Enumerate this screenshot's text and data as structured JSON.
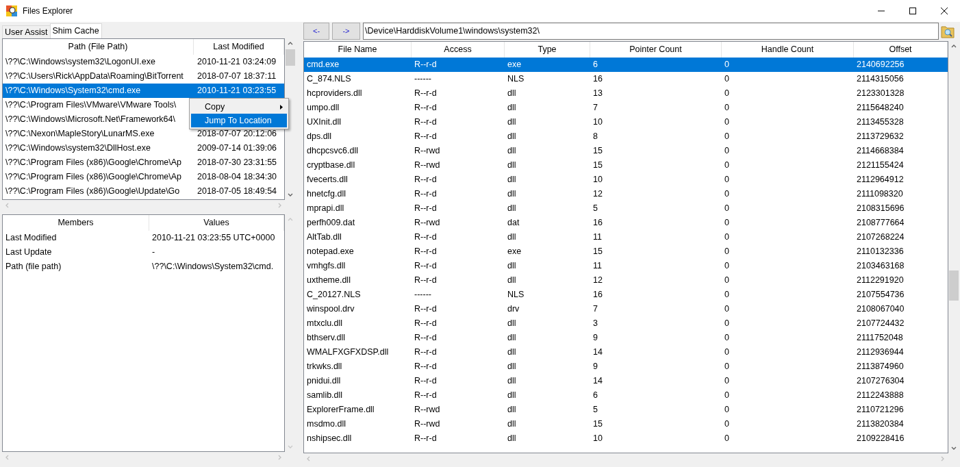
{
  "window": {
    "title": "Files Explorer"
  },
  "tabs": [
    {
      "label": "User Assist",
      "selected": false
    },
    {
      "label": "Shim Cache",
      "selected": true
    }
  ],
  "shim_table": {
    "columns": [
      "Path (File Path)",
      "Last Modified"
    ],
    "rows": [
      {
        "path": "\\??\\C:\\Windows\\system32\\LogonUI.exe",
        "last_modified": "2010-11-21 03:24:09",
        "selected": false
      },
      {
        "path": "\\??\\C:\\Users\\Rick\\AppData\\Roaming\\BitTorrent",
        "last_modified": "2018-07-07 18:37:11",
        "selected": false
      },
      {
        "path": "\\??\\C:\\Windows\\System32\\cmd.exe",
        "last_modified": "2010-11-21 03:23:55",
        "selected": true
      },
      {
        "path": "\\??\\C:\\Program Files\\VMware\\VMware Tools\\",
        "selected": false
      },
      {
        "path": "\\??\\C:\\Windows\\Microsoft.Net\\Framework64\\",
        "selected": false
      },
      {
        "path": "\\??\\C:\\Nexon\\MapleStory\\LunarMS.exe",
        "last_modified": "2018-07-07 20:12:06",
        "selected": false
      },
      {
        "path": "\\??\\C:\\Windows\\system32\\DllHost.exe",
        "last_modified": "2009-07-14 01:39:06",
        "selected": false
      },
      {
        "path": "\\??\\C:\\Program Files (x86)\\Google\\Chrome\\Ap",
        "last_modified": "2018-07-30 23:31:55",
        "selected": false
      },
      {
        "path": "\\??\\C:\\Program Files (x86)\\Google\\Chrome\\Ap",
        "last_modified": "2018-08-04 18:34:30",
        "selected": false
      },
      {
        "path": "\\??\\C:\\Program Files (x86)\\Google\\Update\\Go",
        "last_modified": "2018-07-05 18:49:54",
        "selected": false
      }
    ]
  },
  "context_menu": {
    "items": [
      {
        "label": "Copy",
        "submenu": true,
        "selected": false
      },
      {
        "label": "Jump To Location",
        "submenu": false,
        "selected": true
      }
    ]
  },
  "details": {
    "columns": [
      "Members",
      "Values"
    ],
    "rows": [
      {
        "member": "Last Modified",
        "value": "2010-11-21 03:23:55 UTC+0000"
      },
      {
        "member": "Last Update",
        "value": "-"
      },
      {
        "member": "Path (file path)",
        "value": "\\??\\C:\\Windows\\System32\\cmd."
      }
    ]
  },
  "navigation": {
    "back": "<-",
    "forward": "->",
    "path": "\\Device\\HarddiskVolume1\\windows\\system32\\"
  },
  "files": {
    "columns": [
      "File Name",
      "Access",
      "Type",
      "Pointer Count",
      "Handle Count",
      "Offset"
    ],
    "rows": [
      {
        "cells": [
          "cmd.exe",
          "R--r-d",
          "exe",
          "6",
          "0",
          "2140692256"
        ],
        "selected": true
      },
      {
        "cells": [
          "C_874.NLS",
          "------",
          "NLS",
          "16",
          "0",
          "2114315056"
        ],
        "selected": false
      },
      {
        "cells": [
          "hcproviders.dll",
          "R--r-d",
          "dll",
          "13",
          "0",
          "2123301328"
        ],
        "selected": false
      },
      {
        "cells": [
          "umpo.dll",
          "R--r-d",
          "dll",
          "7",
          "0",
          "2115648240"
        ],
        "selected": false
      },
      {
        "cells": [
          "UXInit.dll",
          "R--r-d",
          "dll",
          "10",
          "0",
          "2113455328"
        ],
        "selected": false
      },
      {
        "cells": [
          "dps.dll",
          "R--r-d",
          "dll",
          "8",
          "0",
          "2113729632"
        ],
        "selected": false
      },
      {
        "cells": [
          "dhcpcsvc6.dll",
          "R--rwd",
          "dll",
          "15",
          "0",
          "2114668384"
        ],
        "selected": false
      },
      {
        "cells": [
          "cryptbase.dll",
          "R--rwd",
          "dll",
          "15",
          "0",
          "2121155424"
        ],
        "selected": false
      },
      {
        "cells": [
          "fvecerts.dll",
          "R--r-d",
          "dll",
          "10",
          "0",
          "2112964912"
        ],
        "selected": false
      },
      {
        "cells": [
          "hnetcfg.dll",
          "R--r-d",
          "dll",
          "12",
          "0",
          "2111098320"
        ],
        "selected": false
      },
      {
        "cells": [
          "mprapi.dll",
          "R--r-d",
          "dll",
          "5",
          "0",
          "2108315696"
        ],
        "selected": false
      },
      {
        "cells": [
          "perfh009.dat",
          "R--rwd",
          "dat",
          "16",
          "0",
          "2108777664"
        ],
        "selected": false
      },
      {
        "cells": [
          "AltTab.dll",
          "R--r-d",
          "dll",
          "11",
          "0",
          "2107268224"
        ],
        "selected": false
      },
      {
        "cells": [
          "notepad.exe",
          "R--r-d",
          "exe",
          "15",
          "0",
          "2110132336"
        ],
        "selected": false
      },
      {
        "cells": [
          "vmhgfs.dll",
          "R--r-d",
          "dll",
          "11",
          "0",
          "2103463168"
        ],
        "selected": false
      },
      {
        "cells": [
          "uxtheme.dll",
          "R--r-d",
          "dll",
          "12",
          "0",
          "2112291920"
        ],
        "selected": false
      },
      {
        "cells": [
          "C_20127.NLS",
          "------",
          "NLS",
          "16",
          "0",
          "2107554736"
        ],
        "selected": false
      },
      {
        "cells": [
          "winspool.drv",
          "R--r-d",
          "drv",
          "7",
          "0",
          "2108067040"
        ],
        "selected": false
      },
      {
        "cells": [
          "mtxclu.dll",
          "R--r-d",
          "dll",
          "3",
          "0",
          "2107724432"
        ],
        "selected": false
      },
      {
        "cells": [
          "bthserv.dll",
          "R--r-d",
          "dll",
          "9",
          "0",
          "2111752048"
        ],
        "selected": false
      },
      {
        "cells": [
          "WMALFXGFXDSP.dll",
          "R--r-d",
          "dll",
          "14",
          "0",
          "2112936944"
        ],
        "selected": false
      },
      {
        "cells": [
          "trkwks.dll",
          "R--r-d",
          "dll",
          "9",
          "0",
          "2113874960"
        ],
        "selected": false
      },
      {
        "cells": [
          "pnidui.dll",
          "R--r-d",
          "dll",
          "14",
          "0",
          "2107276304"
        ],
        "selected": false
      },
      {
        "cells": [
          "samlib.dll",
          "R--r-d",
          "dll",
          "6",
          "0",
          "2112243888"
        ],
        "selected": false
      },
      {
        "cells": [
          "ExplorerFrame.dll",
          "R--rwd",
          "dll",
          "5",
          "0",
          "2110721296"
        ],
        "selected": false
      },
      {
        "cells": [
          "msdmo.dll",
          "R--rwd",
          "dll",
          "15",
          "0",
          "2113820384"
        ],
        "selected": false
      },
      {
        "cells": [
          "nshipsec.dll",
          "R--r-d",
          "dll",
          "10",
          "0",
          "2109228416"
        ],
        "selected": false
      }
    ]
  }
}
